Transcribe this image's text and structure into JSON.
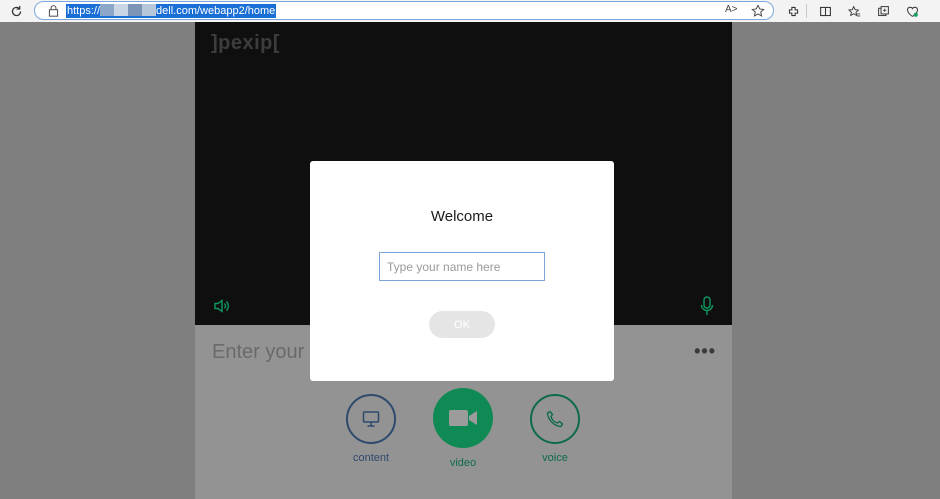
{
  "browser": {
    "url_prefix": "https://",
    "url_suffix": "dell.com/webapp2/home",
    "read_aloud_label": "A˃"
  },
  "app": {
    "logo": "]pexip[",
    "name_placeholder": "Enter your",
    "more_label": "•••",
    "buttons": {
      "content": "content",
      "video": "video",
      "voice": "voice"
    },
    "accent_color": "#0f8a55"
  },
  "modal": {
    "title": "Welcome",
    "input_placeholder": "Type your name here",
    "input_value": "",
    "ok_label": "OK"
  }
}
